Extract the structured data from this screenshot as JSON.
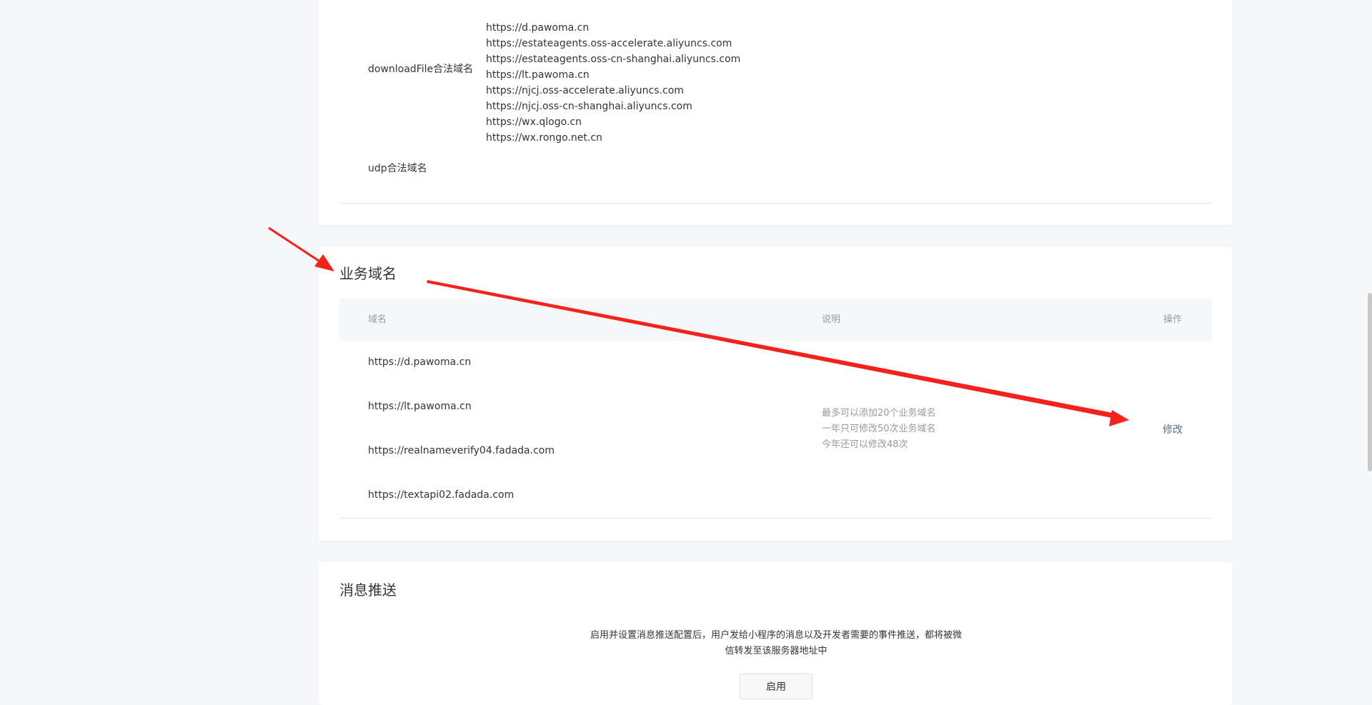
{
  "server_domains": {
    "downloadfile_label": "downloadFile合法域名",
    "downloadfile_domains": [
      "https://d.pawoma.cn",
      "https://estateagents.oss-accelerate.aliyuncs.com",
      "https://estateagents.oss-cn-shanghai.aliyuncs.com",
      "https://lt.pawoma.cn",
      "https://njcj.oss-accelerate.aliyuncs.com",
      "https://njcj.oss-cn-shanghai.aliyuncs.com",
      "https://wx.qlogo.cn",
      "https://wx.rongo.net.cn"
    ],
    "udp_label": "udp合法域名"
  },
  "business_domains": {
    "title": "业务域名",
    "headers": {
      "domain": "域名",
      "note": "说明",
      "action": "操作"
    },
    "rows": [
      "https://d.pawoma.cn",
      "https://lt.pawoma.cn",
      "https://realnameverify04.fadada.com",
      "https://textapi02.fadada.com"
    ],
    "notes": [
      "最多可以添加20个业务域名",
      "一年只可修改50次业务域名",
      "今年还可以修改48次"
    ],
    "modify_label": "修改"
  },
  "message_push": {
    "title": "消息推送",
    "description": "启用并设置消息推送配置后，用户发给小程序的消息以及开发者需要的事件推送，都将被微信转发至该服务器地址中",
    "enable_label": "启用"
  },
  "colors": {
    "page_bg": "#f6f7f9",
    "card_bg": "#ffffff",
    "link": "#576b95",
    "annotation_arrow": "#f5221b"
  }
}
